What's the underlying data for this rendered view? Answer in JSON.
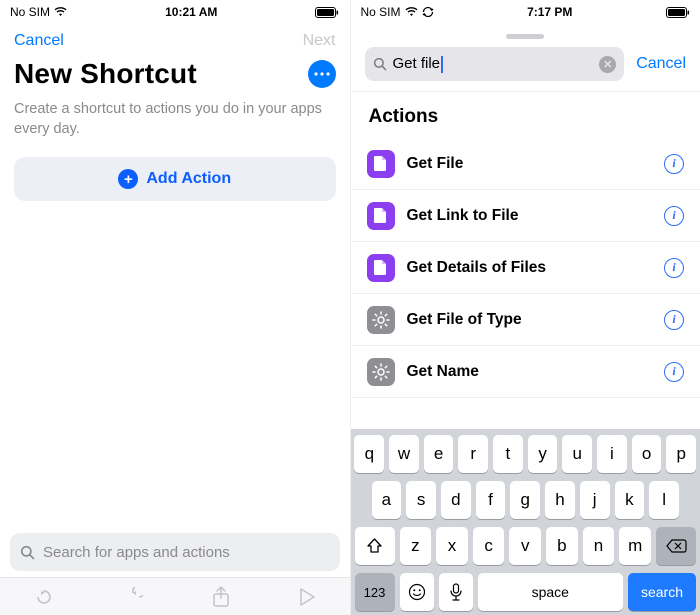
{
  "left": {
    "status": {
      "carrier": "No SIM",
      "time": "10:21 AM"
    },
    "nav": {
      "cancel": "Cancel",
      "next": "Next"
    },
    "title": "New Shortcut",
    "subtitle": "Create a shortcut to actions you do in your apps every day.",
    "addAction": "Add Action",
    "searchPlaceholder": "Search for apps and actions"
  },
  "right": {
    "status": {
      "carrier": "No SIM",
      "time": "7:17 PM"
    },
    "search": {
      "value": "Get file",
      "cancel": "Cancel"
    },
    "sectionTitle": "Actions",
    "actions": [
      {
        "label": "Get File",
        "icon": "file",
        "color": "purple"
      },
      {
        "label": "Get Link to File",
        "icon": "file",
        "color": "purple"
      },
      {
        "label": "Get Details of Files",
        "icon": "file",
        "color": "purple"
      },
      {
        "label": "Get File of Type",
        "icon": "gear",
        "color": "grey"
      },
      {
        "label": "Get Name",
        "icon": "gear",
        "color": "grey"
      }
    ],
    "keyboard": {
      "row1": [
        "q",
        "w",
        "e",
        "r",
        "t",
        "y",
        "u",
        "i",
        "o",
        "p"
      ],
      "row2": [
        "a",
        "s",
        "d",
        "f",
        "g",
        "h",
        "j",
        "k",
        "l"
      ],
      "row3": [
        "z",
        "x",
        "c",
        "v",
        "b",
        "n",
        "m"
      ],
      "numKey": "123",
      "space": "space",
      "search": "search"
    }
  }
}
